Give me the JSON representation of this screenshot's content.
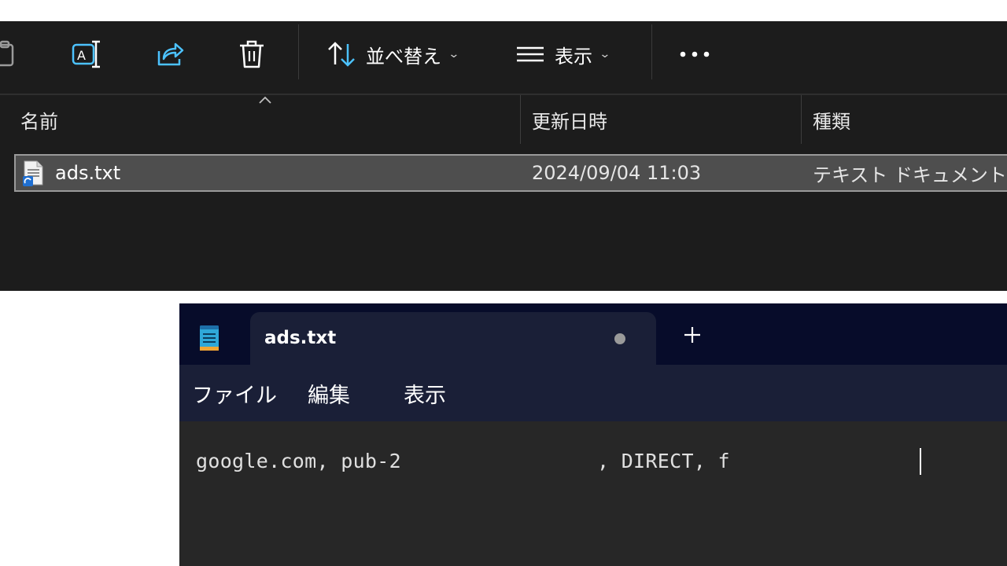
{
  "explorer": {
    "toolbar": {
      "copy_icon": "clipboard-icon",
      "rename_icon": "rename-icon",
      "share_icon": "share-icon",
      "delete_icon": "trash-icon",
      "sort_label": "並べ替え",
      "view_label": "表示",
      "more_icon": "more-icon"
    },
    "columns": {
      "name": "名前",
      "modified": "更新日時",
      "type": "種類"
    },
    "files": [
      {
        "name": "ads.txt",
        "modified": "2024/09/04 11:03",
        "type": "テキスト ドキュメント",
        "icon": "text-file-icon"
      }
    ]
  },
  "notepad": {
    "tab_title": "ads.txt",
    "menu": [
      "ファイル",
      "編集",
      "表示"
    ],
    "line_part1": "google.com, pub-2",
    "line_part2": ", DIRECT, f"
  },
  "colors": {
    "explorer_bg": "#1c1c1c",
    "selected_row": "#4e4e4e",
    "accent_icon": "#4cc2ff",
    "notepad_title": "#070c2a",
    "notepad_menu": "#1a1f37",
    "editor_bg": "#272727"
  }
}
